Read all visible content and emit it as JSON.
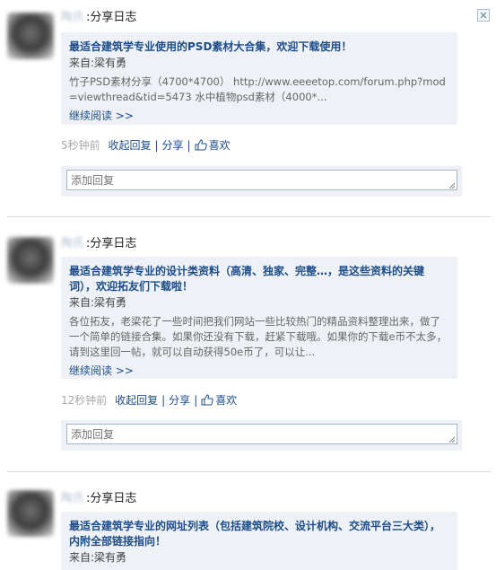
{
  "close_label": "×",
  "posts": [
    {
      "username": "陶氏",
      "action": ":分享日志",
      "card_title": "最适合建筑学专业使用的PSD素材大合集，欢迎下载使用！",
      "from_prefix": "来自:",
      "from_name": "梁有勇",
      "body": "竹子PSD素材分享（4700*4700） http://www.eeeetop.com/forum.php?mod=viewthread&tid=5473 水中植物psd素材（4000*...",
      "more": "继续阅读 >>",
      "time": "5秒钟前",
      "collapse": "收起回复",
      "share": "分享",
      "like": "喜欢",
      "reply_placeholder": "添加回复"
    },
    {
      "username": "陶氏",
      "action": ":分享日志",
      "card_title": "最适合建筑学专业的设计类资料（高清、独家、完整…，是这些资料的关键词），欢迎拓友们下载啦！",
      "from_prefix": "来自:",
      "from_name": "梁有勇",
      "body": "各位拓友，老梁花了一些时间把我们网站一些比较热门的精品资料整理出来，做了一个简单的链接合集。如果你还没有下载，赶紧下载哦。如果你的下载e币不太多，请到这里回一帖，就可以自动获得50e币了，可以让...",
      "more": "继续阅读 >>",
      "time": "12秒钟前",
      "collapse": "收起回复",
      "share": "分享",
      "like": "喜欢",
      "reply_placeholder": "添加回复"
    },
    {
      "username": "陶氏",
      "action": ":分享日志",
      "card_title": "最适合建筑学专业的网址列表（包括建筑院校、设计机构、交流平台三大类），内附全部链接指向！",
      "from_prefix": "来自:",
      "from_name": "梁有勇"
    }
  ]
}
